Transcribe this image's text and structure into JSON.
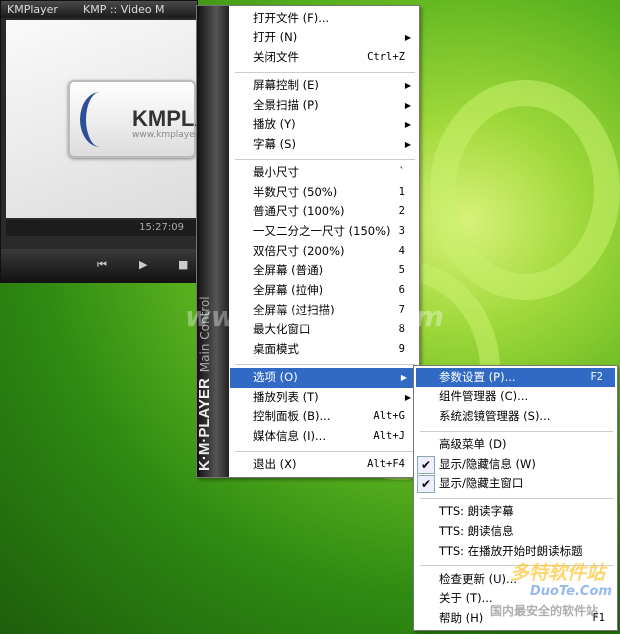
{
  "player": {
    "title_left": "KMPlayer",
    "title_right": "KMP :: Video M",
    "logo_text": "KMPLA",
    "logo_url": "www.kmplayer.",
    "time": "15:27:09",
    "controls": [
      "⏮",
      "▶",
      "■"
    ]
  },
  "main_menu": {
    "strip_brand": "K·M·PLAYER",
    "strip_sub": "Main Control",
    "items": [
      {
        "label": "打开文件 (F)..."
      },
      {
        "label": "打开 (N)",
        "arrow": true
      },
      {
        "label": "关闭文件",
        "shortcut": "Ctrl+Z"
      },
      {
        "sep": true
      },
      {
        "label": "屏幕控制 (E)",
        "arrow": true
      },
      {
        "label": "全景扫描 (P)",
        "arrow": true
      },
      {
        "label": "播放 (Y)",
        "arrow": true
      },
      {
        "label": "字幕 (S)",
        "arrow": true
      },
      {
        "sep": true
      },
      {
        "label": "最小尺寸",
        "shortcut": "`"
      },
      {
        "label": "半数尺寸 (50%)",
        "shortcut": "1"
      },
      {
        "label": "普通尺寸 (100%)",
        "shortcut": "2"
      },
      {
        "label": "一又二分之一尺寸 (150%)",
        "shortcut": "3"
      },
      {
        "label": "双倍尺寸 (200%)",
        "shortcut": "4"
      },
      {
        "label": "全屏幕 (普通)",
        "shortcut": "5"
      },
      {
        "label": "全屏幕 (拉伸)",
        "shortcut": "6"
      },
      {
        "label": "全屏幕 (过扫描)",
        "shortcut": "7"
      },
      {
        "label": "最大化窗口",
        "shortcut": "8"
      },
      {
        "label": "桌面模式",
        "shortcut": "9"
      },
      {
        "sep": true
      },
      {
        "label": "选项 (O)",
        "arrow": true,
        "highlighted": true
      },
      {
        "label": "播放列表 (T)",
        "arrow": true
      },
      {
        "label": "控制面板 (B)...",
        "shortcut": "Alt+G"
      },
      {
        "label": "媒体信息 (I)...",
        "shortcut": "Alt+J"
      },
      {
        "sep": true
      },
      {
        "label": "退出 (X)",
        "shortcut": "Alt+F4"
      }
    ]
  },
  "sub_menu": {
    "items": [
      {
        "label": "参数设置 (P)...",
        "shortcut": "F2",
        "highlighted": true
      },
      {
        "label": "组件管理器 (C)..."
      },
      {
        "label": "系统滤镜管理器 (S)..."
      },
      {
        "sep": true
      },
      {
        "label": "高级菜单 (D)"
      },
      {
        "label": "显示/隐藏信息 (W)",
        "checked": true
      },
      {
        "label": "显示/隐藏主窗口",
        "checked": true
      },
      {
        "sep": true
      },
      {
        "label": "TTS: 朗读字幕"
      },
      {
        "label": "TTS: 朗读信息"
      },
      {
        "label": "TTS: 在播放开始时朗读标题"
      },
      {
        "sep": true
      },
      {
        "label": "检查更新 (U)..."
      },
      {
        "label": "关于 (T)..."
      },
      {
        "label": "帮助 (H)",
        "shortcut": "F1"
      }
    ]
  },
  "watermark": {
    "url": "www.DuoTe.com",
    "brand": "多特软件站",
    "brand_en": "DuoTe.Com",
    "slogan": "国内最安全的软件站"
  },
  "colors": {
    "highlight": "#316ac5"
  }
}
